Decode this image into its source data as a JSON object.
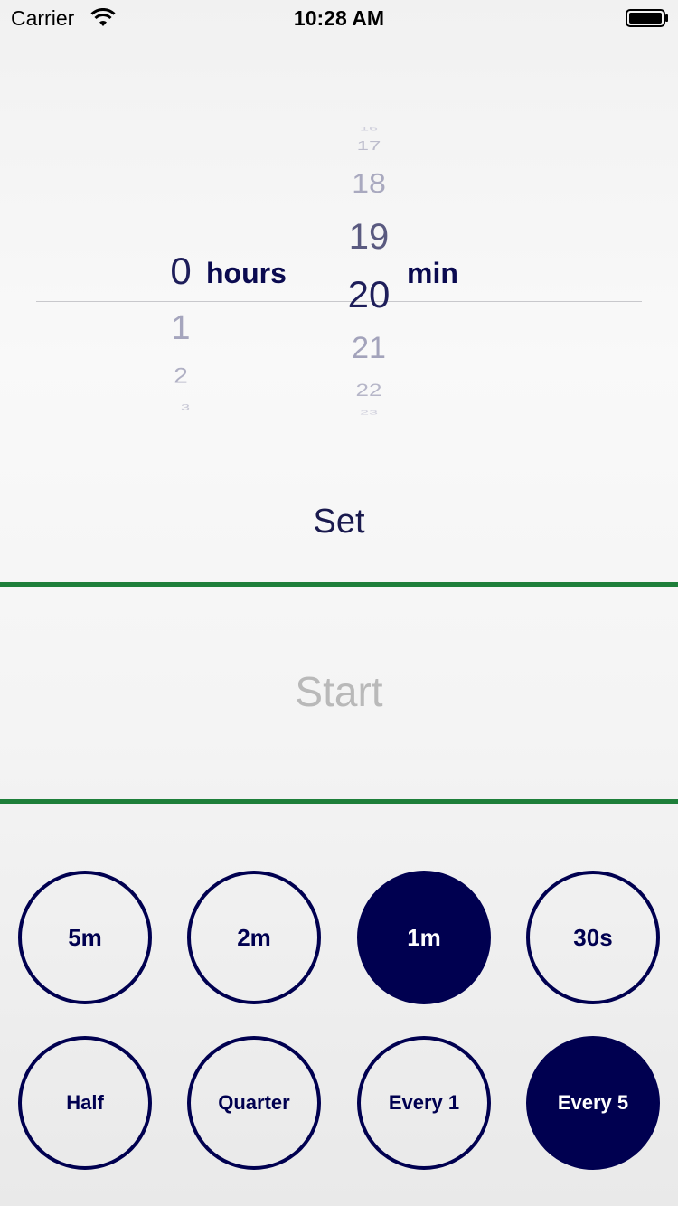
{
  "status_bar": {
    "carrier": "Carrier",
    "time": "10:28 AM"
  },
  "picker": {
    "hours_unit": "hours",
    "minutes_unit": "min",
    "hours": {
      "selected": "0",
      "below": [
        "1",
        "2",
        "3"
      ]
    },
    "minutes": {
      "above": [
        "16",
        "17",
        "18",
        "19"
      ],
      "selected": "20",
      "below": [
        "21",
        "22",
        "23"
      ]
    }
  },
  "actions": {
    "set": "Set",
    "start": "Start"
  },
  "intervals": [
    {
      "label": "5m",
      "active": false
    },
    {
      "label": "2m",
      "active": false
    },
    {
      "label": "1m",
      "active": true
    },
    {
      "label": "30s",
      "active": false
    }
  ],
  "modes": [
    {
      "label": "Half",
      "active": false
    },
    {
      "label": "Quarter",
      "active": false
    },
    {
      "label": "Every 1",
      "active": false
    },
    {
      "label": "Every 5",
      "active": true
    }
  ],
  "colors": {
    "accent": "#000050",
    "divider": "#1e7f3a",
    "start_disabled": "#b9b9b9"
  }
}
